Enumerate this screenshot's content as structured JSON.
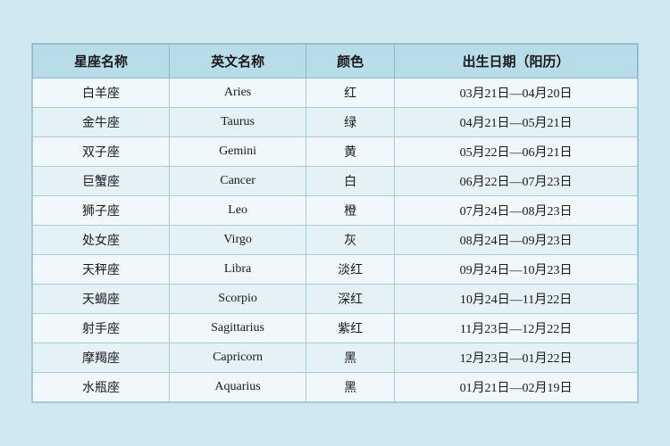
{
  "table": {
    "headers": [
      "星座名称",
      "英文名称",
      "颜色",
      "出生日期（阳历）"
    ],
    "rows": [
      {
        "zh": "白羊座",
        "en": "Aries",
        "color": "红",
        "dates": "03月21日—04月20日"
      },
      {
        "zh": "金牛座",
        "en": "Taurus",
        "color": "绿",
        "dates": "04月21日—05月21日"
      },
      {
        "zh": "双子座",
        "en": "Gemini",
        "color": "黄",
        "dates": "05月22日—06月21日"
      },
      {
        "zh": "巨蟹座",
        "en": "Cancer",
        "color": "白",
        "dates": "06月22日—07月23日"
      },
      {
        "zh": "狮子座",
        "en": "Leo",
        "color": "橙",
        "dates": "07月24日—08月23日"
      },
      {
        "zh": "处女座",
        "en": "Virgo",
        "color": "灰",
        "dates": "08月24日—09月23日"
      },
      {
        "zh": "天秤座",
        "en": "Libra",
        "color": "淡红",
        "dates": "09月24日—10月23日"
      },
      {
        "zh": "天蝎座",
        "en": "Scorpio",
        "color": "深红",
        "dates": "10月24日—11月22日"
      },
      {
        "zh": "射手座",
        "en": "Sagittarius",
        "color": "紫红",
        "dates": "11月23日—12月22日"
      },
      {
        "zh": "摩羯座",
        "en": "Capricorn",
        "color": "黑",
        "dates": "12月23日—01月22日"
      },
      {
        "zh": "水瓶座",
        "en": "Aquarius",
        "color": "黑",
        "dates": "01月21日—02月19日"
      }
    ]
  }
}
